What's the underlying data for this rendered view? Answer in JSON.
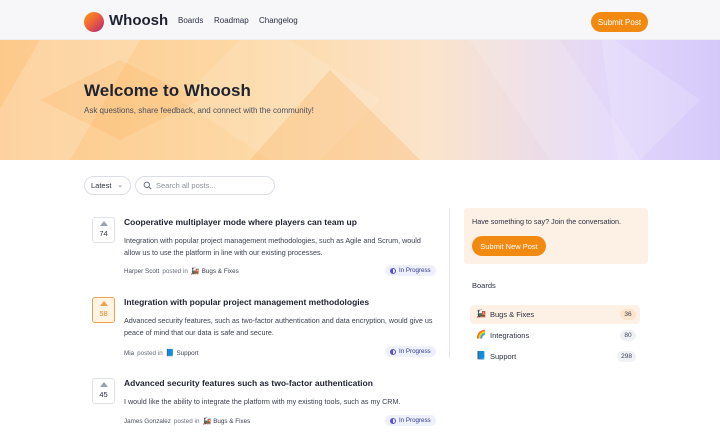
{
  "app": {
    "name": "Whoosh"
  },
  "nav": [
    "Boards",
    "Roadmap",
    "Changelog"
  ],
  "header": {
    "submit_label": "Submit Post"
  },
  "hero": {
    "title": "Welcome to Whoosh",
    "subtitle": "Ask questions, share feedback, and connect with the community!"
  },
  "filters": {
    "sort": "Latest",
    "search_placeholder": "Search all posts..."
  },
  "posts": [
    {
      "votes": "74",
      "title": "Cooperative multiplayer mode where players can team up",
      "description": "Integration with popular project management methodologies, such as Agile and Scrum, would allow us to use the platform in line with our existing processes.",
      "author": "Harper Scott",
      "posted_in": "posted in",
      "board_icon": "🚂",
      "board": "Bugs & Fixes",
      "status": "In Progress"
    },
    {
      "votes": "58",
      "title": "Integration with popular project management methodologies",
      "description": "Advanced security features, such as two-factor authentication and data encryption, would give us peace of mind that our data is safe and secure.",
      "author": "Mia",
      "posted_in": "posted in",
      "board_icon": "📘",
      "board": "Support",
      "status": "In Progress"
    },
    {
      "votes": "45",
      "title": "Advanced security features such as two-factor authentication",
      "description": "I would like the ability to integrate the platform with my existing tools, such as my CRM.",
      "author": "James Gonzalez",
      "posted_in": "posted in",
      "board_icon": "🚂",
      "board": "Bugs & Fixes",
      "status": "In Progress"
    }
  ],
  "sidebar": {
    "cta_text": "Have something to say? Join the conversation.",
    "cta_button": "Submit New Post",
    "boards_heading": "Boards",
    "boards": [
      {
        "icon": "🚂",
        "name": "Bugs & Fixes",
        "count": "36"
      },
      {
        "icon": "🌈",
        "name": "Integrations",
        "count": "80"
      },
      {
        "icon": "📘",
        "name": "Support",
        "count": "298"
      }
    ]
  },
  "colors": {
    "accent": "#f28a12",
    "status": "#5a4fd1"
  }
}
